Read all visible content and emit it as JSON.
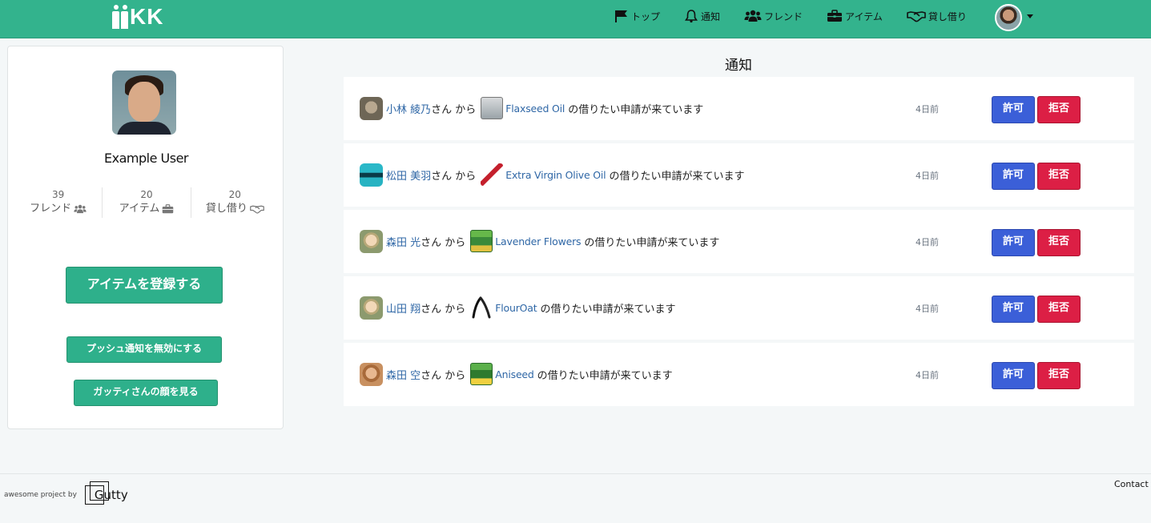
{
  "navbar": {
    "logo_text": "KK",
    "accent_color": "#33b38d",
    "links": [
      {
        "label": "トップ",
        "icon": "flag-icon"
      },
      {
        "label": "通知",
        "icon": "bell-icon"
      },
      {
        "label": "フレンド",
        "icon": "users-icon"
      },
      {
        "label": "アイテム",
        "icon": "briefcase-icon"
      },
      {
        "label": "貸し借り",
        "icon": "handshake-icon"
      }
    ],
    "avatar_icon": "user-avatar"
  },
  "profile": {
    "name": "Example User",
    "stats": [
      {
        "value": "39",
        "label": "フレンド",
        "icon": "users-icon"
      },
      {
        "value": "20",
        "label": "アイテム",
        "icon": "briefcase-icon"
      },
      {
        "value": "20",
        "label": "貸し借り",
        "icon": "handshake-icon"
      }
    ],
    "register_button": "アイテムを登録する",
    "push_button": "プッシュ通知を無効にする",
    "face_button": "ガッティさんの顔を見る"
  },
  "notifications": {
    "title": "通知",
    "items": [
      {
        "user": "小林 綾乃",
        "suffix": "さん から",
        "item": "Flaxseed Oil",
        "message": "の借りたい申請が来ています",
        "time": "4日前",
        "allow": "許可",
        "deny": "拒否"
      },
      {
        "user": "松田 美羽",
        "suffix": "さん から",
        "item": "Extra Virgin Olive Oil",
        "message": "の借りたい申請が来ています",
        "time": "4日前",
        "allow": "許可",
        "deny": "拒否"
      },
      {
        "user": "森田 光",
        "suffix": "さん から",
        "item": "Lavender Flowers",
        "message": "の借りたい申請が来ています",
        "time": "4日前",
        "allow": "許可",
        "deny": "拒否"
      },
      {
        "user": "山田 翔",
        "suffix": "さん から",
        "item": "FlourOat",
        "message": "の借りたい申請が来ています",
        "time": "4日前",
        "allow": "許可",
        "deny": "拒否"
      },
      {
        "user": "森田 空",
        "suffix": "さん から",
        "item": "Aniseed",
        "message": "の借りたい申請が来ています",
        "time": "4日前",
        "allow": "許可",
        "deny": "拒否"
      }
    ]
  },
  "footer": {
    "credit": "awesome project by",
    "brand": "Gutty",
    "contact": "Contact"
  }
}
